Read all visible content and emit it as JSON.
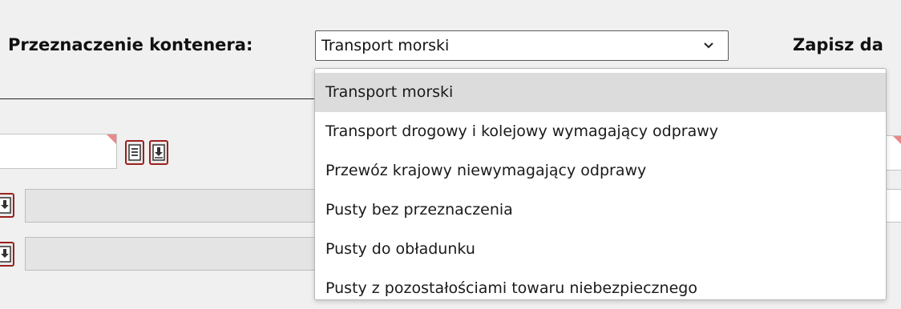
{
  "container_purpose": {
    "label": "Przeznaczenie kontenera:",
    "selected_value": "Transport morski",
    "options": [
      "Transport morski",
      "Transport drogowy i kolejowy wymagający odprawy",
      "Przewóz krajowy niewymagający odprawy",
      "Pusty bez przeznaczenia",
      "Pusty do obładunku",
      "Pusty z pozostałościami towaru niebezpiecznego"
    ]
  },
  "save_label_truncated": "Zapisz da",
  "colors": {
    "icon_border": "#9b2020",
    "required_corner": "#e88a8a",
    "selected_option_bg": "#dcdcdc"
  }
}
